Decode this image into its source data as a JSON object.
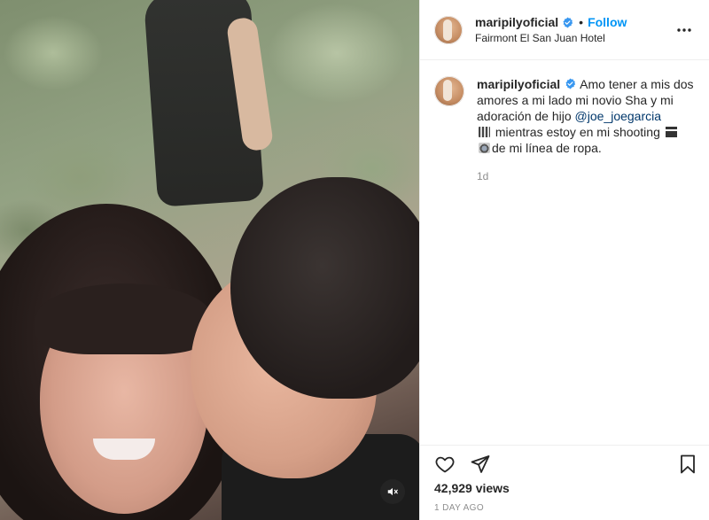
{
  "post": {
    "username": "maripilyoficial",
    "follow_label": "Follow",
    "separator": "•",
    "location": "Fairmont El San Juan Hotel",
    "caption": {
      "text_1": "Amo tener a mis dos amores a mi lado mi novio Sha y mi adoración de hijo ",
      "mention": "@joe_joegarcia",
      "text_2": " mientras estoy en mi shooting ",
      "text_3": "de mi línea de ropa.",
      "time_ago": "1d"
    },
    "views": "42,929 views",
    "date": "1 DAY AGO"
  },
  "icons": {
    "verified": "verified-badge-icon",
    "more": "more-options-icon",
    "like": "heart-icon",
    "share": "paper-plane-icon",
    "save": "bookmark-icon",
    "mute": "muted-speaker-icon"
  },
  "colors": {
    "accent": "#0095f6",
    "verified": "#3897f0",
    "text": "#262626",
    "muted": "#8e8e8e",
    "mention": "#00376b"
  }
}
